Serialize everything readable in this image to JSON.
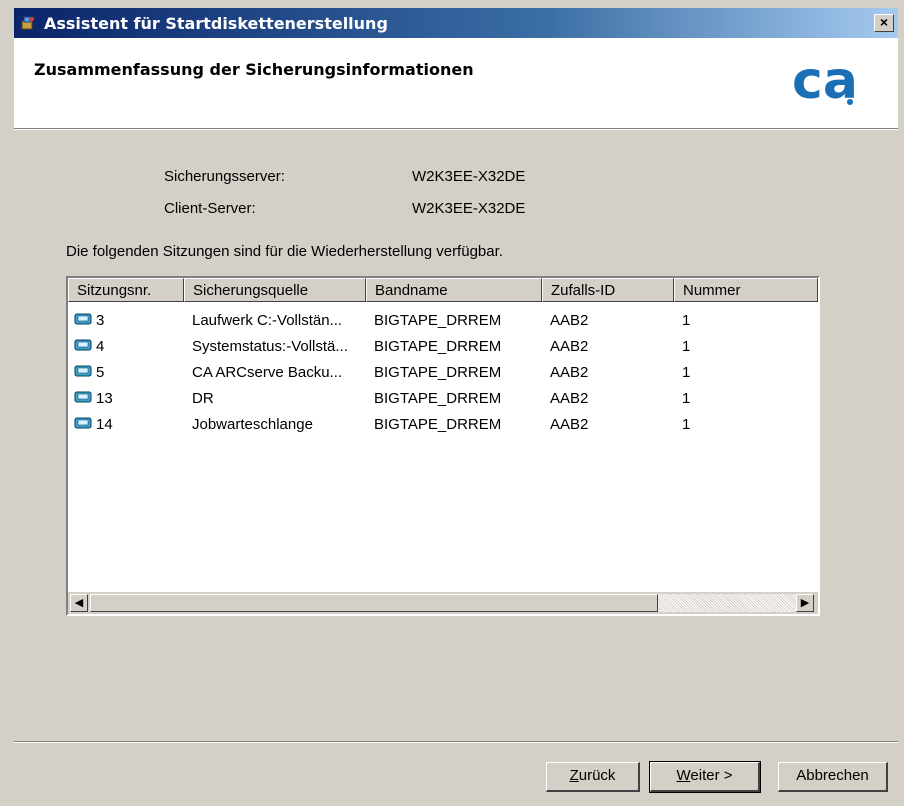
{
  "window": {
    "title": "Assistent für Startdiskettenerstellung",
    "close_label": "×"
  },
  "header": {
    "title": "Zusammenfassung der Sicherungsinformationen",
    "logo_text": "ca",
    "logo_color": "#1a6fb5"
  },
  "summary": {
    "server_label": "Sicherungsserver:",
    "server_value": "W2K3EE-X32DE",
    "client_label": "Client-Server:",
    "client_value": "W2K3EE-X32DE",
    "info_text": "Die folgenden Sitzungen sind für die Wiederherstellung verfügbar."
  },
  "list": {
    "columns": [
      "Sitzungsnr.",
      "Sicherungsquelle",
      "Bandname",
      "Zufalls-ID",
      "Nummer"
    ],
    "rows": [
      {
        "session": "3",
        "source": "Laufwerk C:-Vollstän...",
        "tape": "BIGTAPE_DRREM",
        "random_id": "AAB2",
        "number": "1"
      },
      {
        "session": "4",
        "source": "Systemstatus:-Vollstä...",
        "tape": "BIGTAPE_DRREM",
        "random_id": "AAB2",
        "number": "1"
      },
      {
        "session": "5",
        "source": "CA ARCserve Backu...",
        "tape": "BIGTAPE_DRREM",
        "random_id": "AAB2",
        "number": "1"
      },
      {
        "session": "13",
        "source": "DR",
        "tape": "BIGTAPE_DRREM",
        "random_id": "AAB2",
        "number": "1"
      },
      {
        "session": "14",
        "source": "Jobwarteschlange",
        "tape": "BIGTAPE_DRREM",
        "random_id": "AAB2",
        "number": "1"
      }
    ]
  },
  "scrollbar": {
    "left_arrow": "◀",
    "right_arrow": "▶"
  },
  "buttons": {
    "back_access": "Z",
    "back_rest": "urück",
    "next_access": "W",
    "next_rest": "eiter >",
    "cancel": "Abbrechen"
  }
}
